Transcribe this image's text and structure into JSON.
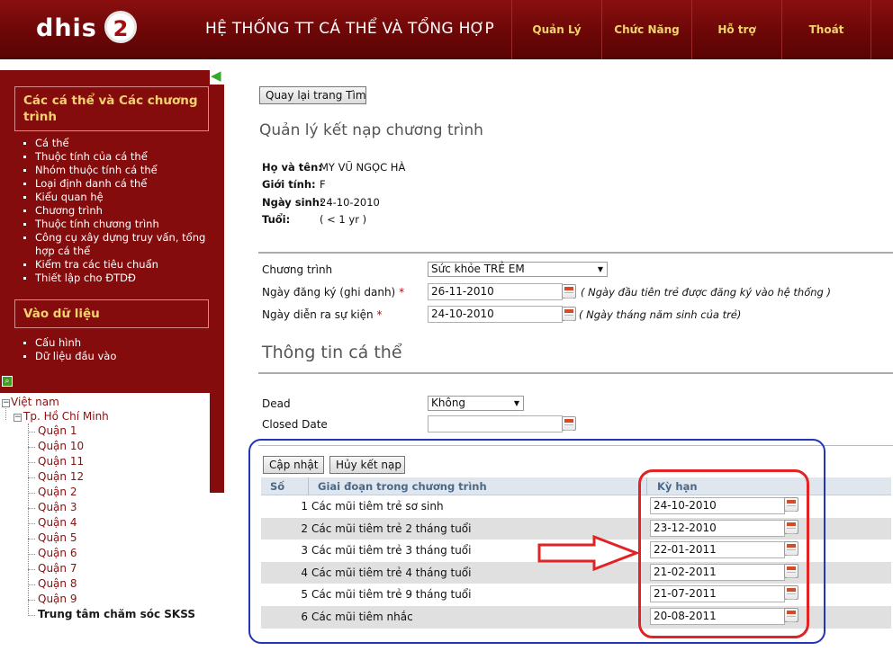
{
  "header": {
    "logo_text": "dhis",
    "logo_badge": "2",
    "title": "HỆ THỐNG TT CÁ THỂ VÀ TỔNG HỢP",
    "nav": [
      "Quản Lý",
      "Chức Năng",
      "Hỗ trợ",
      "Thoát"
    ],
    "nav_color": "#f3d36b",
    "bg_color": "#7a0a0a"
  },
  "sidebar": {
    "section1_title": "Các cá thể và Các chương trình",
    "section1_items": [
      "Cá thể",
      "Thuộc tính của cá thể",
      "Nhóm thuộc tính cá thể",
      "Loại định danh cá thể",
      "Kiểu quan hệ",
      "Chương trình",
      "Thuộc tính chương trình",
      "Công cụ xây dựng truy vấn, tổng hợp cá thể",
      "Kiểm tra các tiêu chuẩn",
      "Thiết lập cho ĐTDĐ"
    ],
    "section2_title": "Vào dữ liệu",
    "section2_items": [
      "Cấu hình",
      "Dữ liệu đầu vào"
    ]
  },
  "tree": {
    "root": "Việt nam",
    "city": "Tp. Hồ Chí Minh",
    "districts": [
      "Quận 1",
      "Quận 10",
      "Quận 11",
      "Quận 12",
      "Quận 2",
      "Quận 3",
      "Quận 4",
      "Quận 5",
      "Quận 6",
      "Quận 7",
      "Quận 8",
      "Quận 9"
    ],
    "selected": "Trung tâm chăm sóc SKSS"
  },
  "main": {
    "back_button": "Quay lại trang Tìm kiế",
    "title": "Quản lý kết nạp chương trình",
    "person": {
      "name_label": "Họ và tên:",
      "name_value": "MY VŨ NGỌC HÀ",
      "gender_label": "Giới tính:",
      "gender_value": "F",
      "dob_label": "Ngày sinh:",
      "dob_value": "24-10-2010",
      "age_label": "Tuổi:",
      "age_value": "( < 1 yr )"
    },
    "form": {
      "program_label": "Chương trình",
      "program_value": "Sức khỏe TRẺ EM",
      "enroll_label": "Ngày đăng ký (ghi danh)",
      "enroll_value": "26-11-2010",
      "enroll_hint": "( Ngày đầu tiên trẻ được đăng ký vào hệ thống )",
      "incident_label": "Ngày diễn ra sự kiện",
      "incident_value": "24-10-2010",
      "incident_hint": "( Ngày tháng năm sinh của trẻ)",
      "required_mark": "*"
    },
    "section_title": "Thông tin cá thể",
    "dead_label": "Dead",
    "dead_value": "Không",
    "closed_label": "Closed Date",
    "closed_value": "",
    "update_button": "Cập nhật",
    "cancel_button": "Hủy kết nạp",
    "table": {
      "headers": [
        "Số",
        "Giai đoạn trong chương trình",
        "Kỳ hạn"
      ],
      "rows": [
        {
          "no": "1",
          "stage": "Các mũi tiêm trẻ sơ sinh",
          "due": "24-10-2010"
        },
        {
          "no": "2",
          "stage": "Các mũi tiêm trẻ 2 tháng tuổi",
          "due": "23-12-2010"
        },
        {
          "no": "3",
          "stage": "Các mũi tiêm trẻ 3 tháng tuổi",
          "due": "22-01-2011"
        },
        {
          "no": "4",
          "stage": "Các mũi tiêm trẻ 4 tháng tuổi",
          "due": "21-02-2011"
        },
        {
          "no": "5",
          "stage": "Các mũi tiêm trẻ 9 tháng tuổi",
          "due": "21-07-2011"
        },
        {
          "no": "6",
          "stage": "Các mũi tiêm nhắc",
          "due": "20-08-2011"
        }
      ]
    }
  },
  "annotation_colors": {
    "blue_frame": "#2436b8",
    "red_frame": "#e22323"
  }
}
